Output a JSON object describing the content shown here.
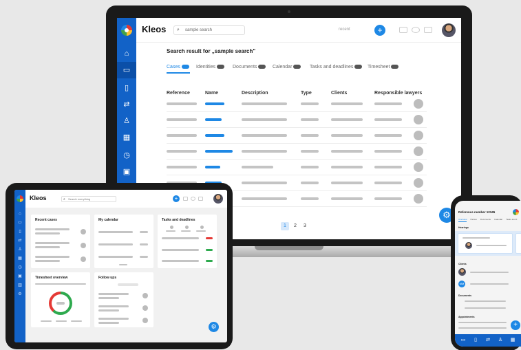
{
  "laptop": {
    "brand": "Kleos",
    "search_value": "sample search",
    "recent_label": "recent",
    "heading": "Search result for „sample search\"",
    "tabs": [
      {
        "label": "Cases",
        "active": true
      },
      {
        "label": "Identities"
      },
      {
        "label": "Documents"
      },
      {
        "label": "Calendar"
      },
      {
        "label": "Tasks and deadlines"
      },
      {
        "label": "Timesheet"
      }
    ],
    "columns": [
      "Reference",
      "Name",
      "Description",
      "Type",
      "Clients",
      "Responsible lawyers"
    ],
    "pagination": [
      "1",
      "2",
      "3"
    ],
    "sidebar_icons": [
      "home-icon",
      "folder-icon",
      "document-icon",
      "transfer-icon",
      "person-icon",
      "calendar-icon",
      "timer-icon",
      "money-icon"
    ]
  },
  "tablet": {
    "brand": "Kleos",
    "search_placeholder": "Search everything",
    "cards": {
      "recent_cases": "Recent cases",
      "my_calendar": "My calendar",
      "tasks": "Tasks and deadlines",
      "timesheet": "Timesheet overview",
      "follow_ups": "Follow ups"
    }
  },
  "phone": {
    "title": "Reference number 12345",
    "tabs": [
      "Overview",
      "Parties",
      "Documents",
      "Calendar",
      "Tasks and d"
    ],
    "sections": {
      "hearings": "Hearings",
      "clients": "Clients",
      "documents": "Documents",
      "appointments": "Appointments"
    },
    "client_initials": "MM"
  },
  "colors": {
    "brand_blue": "#1262c7",
    "accent_blue": "#1e88e5",
    "status_red": "#e53935",
    "status_green": "#2eaa4e"
  }
}
